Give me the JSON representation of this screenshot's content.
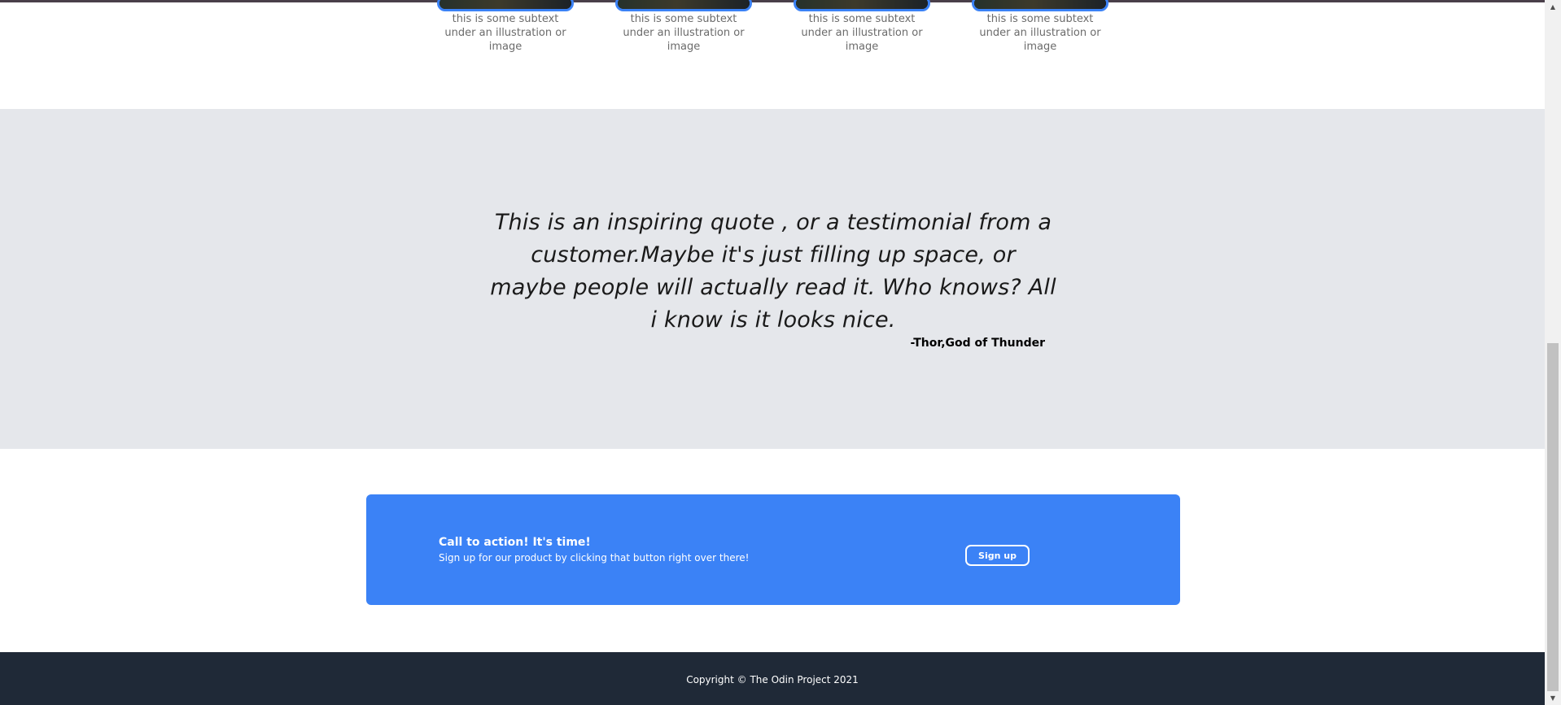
{
  "cards": [
    {
      "caption": "this is some subtext under an illustration or image"
    },
    {
      "caption": "this is some subtext under an illustration or image"
    },
    {
      "caption": "this is some subtext under an illustration or image"
    },
    {
      "caption": "this is some subtext under an illustration or image"
    }
  ],
  "quote": {
    "text": "This is an inspiring quote , or a testimonial from a customer.Maybe it's just filling up space, or maybe people will actually read it. Who knows? All i know is it looks nice.",
    "author": "-Thor,God of Thunder"
  },
  "cta": {
    "title": "Call to action! It's time!",
    "subtitle": "Sign up for our product by clicking that button right over there!",
    "button_label": "Sign up"
  },
  "footer": {
    "copyright": "Copyright © The Odin Project 2021"
  },
  "scrollbar": {
    "up_icon": "▲",
    "down_icon": "▼"
  },
  "colors": {
    "accent": "#3b82f6",
    "quote_band": "#e5e7eb",
    "footer": "#1f2937"
  }
}
